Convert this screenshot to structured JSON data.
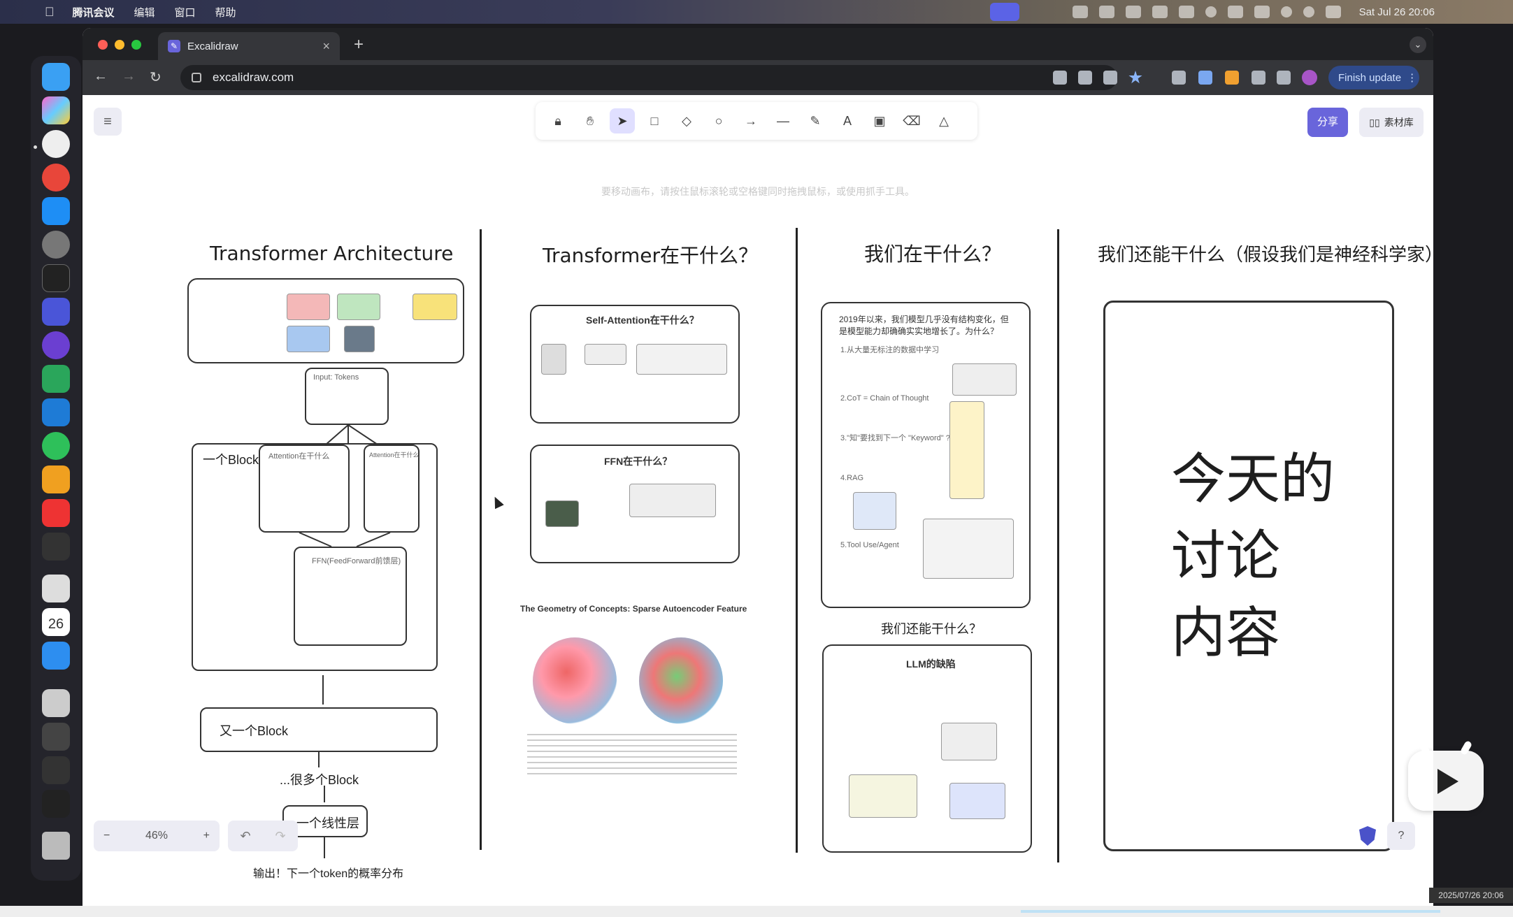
{
  "menubar": {
    "app_name": "腾讯会议",
    "menus": [
      "编辑",
      "窗口",
      "帮助"
    ],
    "clock": "Sat Jul 26  20:06"
  },
  "browser": {
    "tab_title": "Excalidraw",
    "url": "excalidraw.com",
    "finish_update_label": "Finish update"
  },
  "excalidraw": {
    "canvas_hint": "要移动画布，请按住鼠标滚轮或空格键同时拖拽鼠标，或使用抓手工具。",
    "share_label": "分享",
    "library_label": "素材库",
    "zoom_level": "46%",
    "tool_icons": [
      "lock-icon",
      "hand-icon",
      "selection-icon",
      "rectangle-icon",
      "diamond-icon",
      "ellipse-icon",
      "arrow-icon",
      "line-icon",
      "pencil-icon",
      "text-icon",
      "image-icon",
      "eraser-icon",
      "shapes-icon"
    ],
    "active_tool": "selection-icon"
  },
  "board": {
    "col1": {
      "title": "Transformer Architecture",
      "block_label": "一个Block",
      "another_block": "又一个Block",
      "many_blocks": "...很多个Block",
      "linear_layer": "一个线性层",
      "output": "输出！下一个token的概率分布",
      "attention_box_1": "Attention在干什么",
      "attention_box_2": "Attention在干什么",
      "ffn_box": "FFN(FeedForward前馈层)",
      "input_box": "Input: Tokens"
    },
    "col2": {
      "title": "Transformer在干什么？",
      "card1_title": "Self-Attention在干什么？",
      "card2_title": "FFN在干什么？",
      "figure_title": "The Geometry of Concepts: Sparse Autoencoder Feature"
    },
    "col3": {
      "title": "我们在干什么？",
      "card_text": "2019年以来，我们模型几乎没有结构变化，但是模型能力却确确实实地增长了。为什么？",
      "items": [
        "1.从大量无标注的数据中学习",
        "2.CoT = Chain of Thought",
        "3.\"知\"要找到下一个 \"Keyword\" ?",
        "4.RAG",
        "5.Tool Use/Agent"
      ],
      "sub_title": "我们还能干什么？",
      "card2_title": "LLM的缺陷"
    },
    "col4": {
      "title": "我们还能干什么（假设我们是神经科学家）",
      "big_line1": "今天的",
      "big_line2": "讨论",
      "big_line3": "内容"
    }
  },
  "dock": {
    "calendar_day": "26"
  },
  "overlay": {
    "timestamp": "2025/07/26 20:06"
  },
  "colors": {
    "excalidraw_accent": "#6965db",
    "meeting_accent": "#5b63e6"
  }
}
